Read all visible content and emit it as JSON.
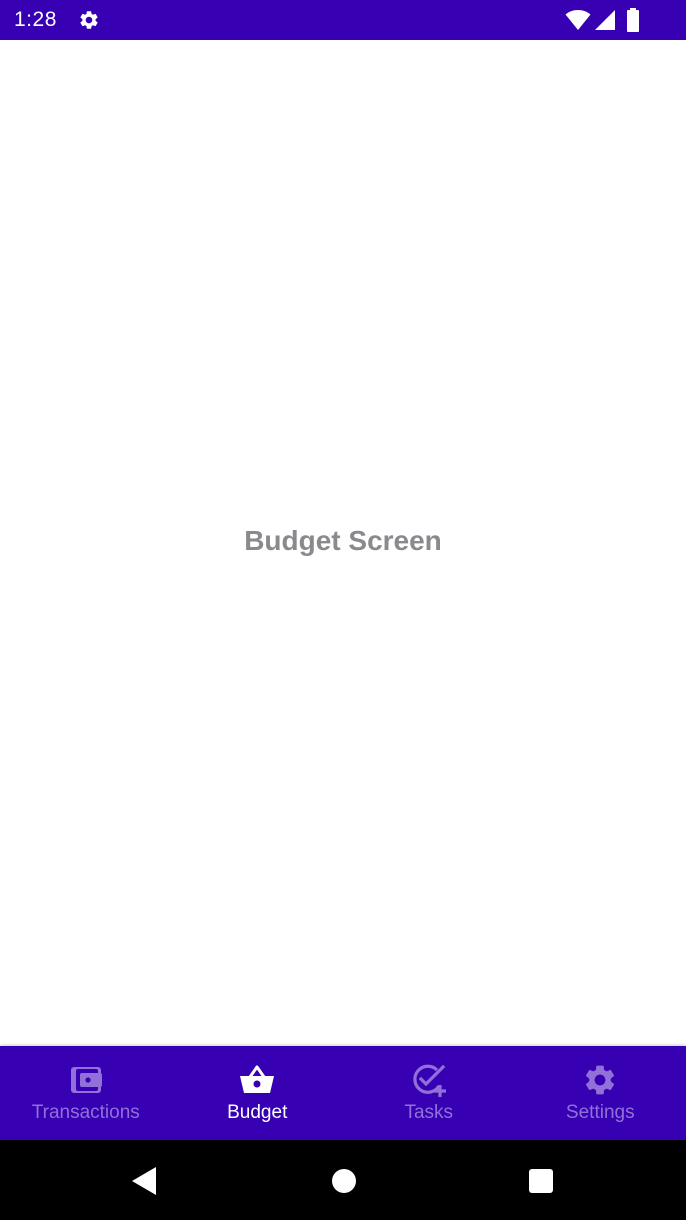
{
  "status_bar": {
    "time": "1:28",
    "icons": [
      "gear-icon",
      "wifi-icon",
      "signal-icon",
      "battery-icon"
    ]
  },
  "content": {
    "center_text": "Budget Screen"
  },
  "bottom_nav": {
    "active_index": 1,
    "items": [
      {
        "label": "Transactions",
        "icon": "wallet-icon",
        "active": false
      },
      {
        "label": "Budget",
        "icon": "basket-icon",
        "active": true
      },
      {
        "label": "Tasks",
        "icon": "check-plus-icon",
        "active": false
      },
      {
        "label": "Settings",
        "icon": "gear-icon",
        "active": false
      }
    ]
  },
  "system_nav": {
    "icons": [
      "back-icon",
      "home-icon",
      "recents-icon"
    ]
  },
  "colors": {
    "primary": "#3700B3",
    "nav_inactive": "#9270d9",
    "nav_active": "#ffffff",
    "center_text": "#8a8a8e",
    "system_nav_bg": "#000000"
  }
}
